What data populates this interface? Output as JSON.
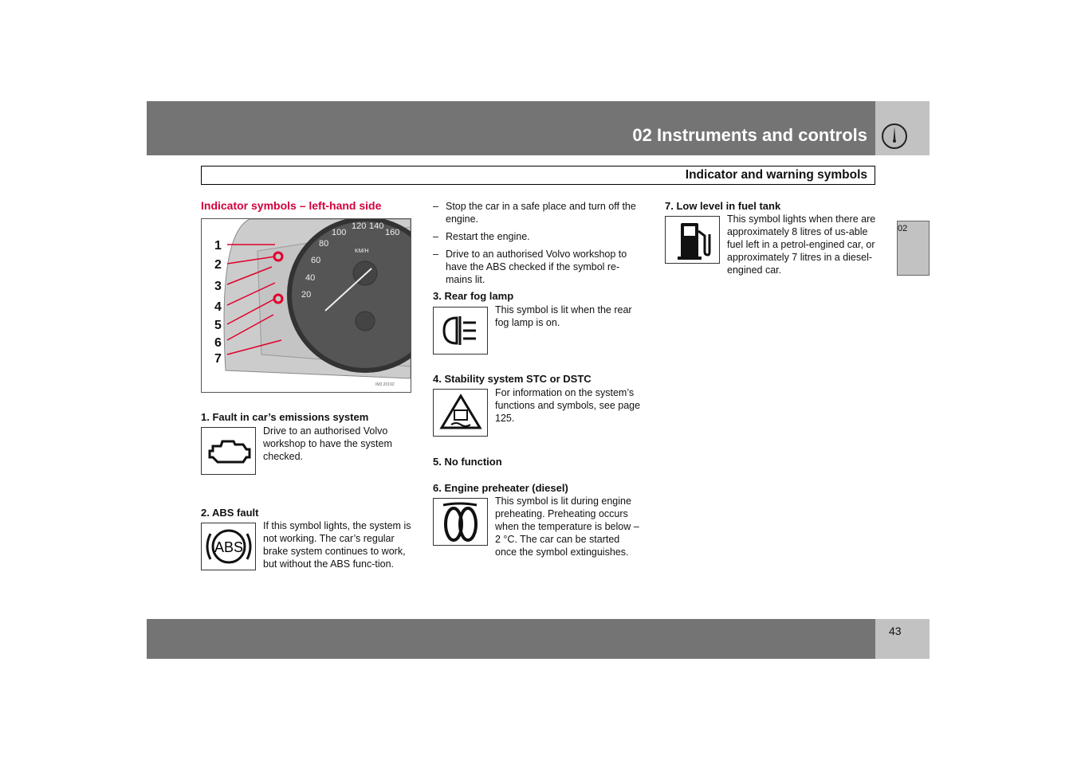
{
  "header": {
    "title": "02 Instruments and controls",
    "icon": "speedometer-icon"
  },
  "section_title": "Indicator and warning symbols",
  "side_tab": "02",
  "page_number": "43",
  "col1": {
    "heading": "Indicator symbols – left-hand side",
    "figure": {
      "labels": [
        "1",
        "2",
        "3",
        "4",
        "5",
        "6",
        "7"
      ],
      "gauge_labels": [
        "20",
        "40",
        "60",
        "80",
        "100",
        "120",
        "140",
        "160",
        "KM/H"
      ],
      "code": "IM3.20192"
    },
    "items": [
      {
        "title": "1. Fault in car’s emissions system",
        "text": "Drive to an authorised Volvo workshop to have the system checked.",
        "icon": "engine-icon"
      },
      {
        "title": "2. ABS fault",
        "text": "If this symbol lights, the system is not working. The car’s regular brake system continues to work, but without the ABS func-tion.",
        "icon": "abs-icon",
        "icon_text": "ABS"
      }
    ]
  },
  "col2": {
    "bullets": [
      "Stop the car in a safe place and turn off the engine.",
      "Restart the engine.",
      "Drive to an authorised Volvo workshop to have the ABS checked if the symbol re-mains lit."
    ],
    "items": [
      {
        "title": "3. Rear fog lamp",
        "text": "This symbol is lit when the rear fog lamp is on.",
        "icon": "rear-fog-lamp-icon"
      },
      {
        "title": "4. Stability system STC or DSTC",
        "text": "For information on the system’s functions and symbols, see page 125.",
        "icon": "stability-system-icon"
      },
      {
        "title": "5. No function",
        "text": ""
      },
      {
        "title": "6. Engine preheater (diesel)",
        "text": "This symbol is lit during engine preheating. Preheating occurs when the temperature is below –2 °C. The car can be started once the symbol extinguishes.",
        "icon": "glow-plug-icon"
      }
    ]
  },
  "col3": {
    "items": [
      {
        "title": "7. Low level in fuel tank",
        "text": "This symbol lights when there are approximately 8 litres of us-able fuel left in a petrol-engined car, or approximately 7 litres in a diesel-engined car.",
        "icon": "fuel-pump-icon"
      }
    ]
  }
}
